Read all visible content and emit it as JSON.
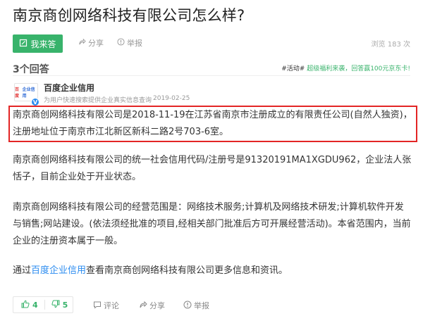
{
  "question": {
    "title": "南京商创网络科技有限公司怎么样?"
  },
  "actions": {
    "answer_label": "我来答",
    "share_label": "分享",
    "report_label": "举报",
    "views_text": "浏览 183 次"
  },
  "answers_header": {
    "count_text": "3个回答",
    "promo_tag": "#活动#",
    "promo_text": "超级福利来袭，回答赢100元京东卡!"
  },
  "answer": {
    "author": {
      "logo_text_1": "百度",
      "logo_text_2": "企业信用",
      "verified_mark": "V",
      "name": "百度企业信用",
      "meta": "为用户快速搜索提供企业真实信息查询",
      "date": "2019-02-25"
    },
    "highlight_lines": [
      "南京商创网络科技有限公司是2018-11-19在江苏省南京市注册成立的有限责任公司(自然人独资)，",
      "注册地址位于南京市江北新区新科二路2号703-6室。"
    ],
    "para1": "南京商创网络科技有限公司的统一社会信用代码/注册号是91320191MA1XGDU962，企业法人张恬子，目前企业处于开业状态。",
    "para2": "南京商创网络科技有限公司的经营范围是：网络技术服务;计算机及网络技术研发;计算机软件开发与销售;网站建设。(依法须经批准的项目,经相关部门批准后方可开展经营活动)。本省范围内，当前企业的注册资本属于一般。",
    "para3_prefix": "通过",
    "para3_link": "百度企业信用",
    "para3_suffix": "查看南京商创网络科技有限公司更多信息和资讯。"
  },
  "footer": {
    "like_count": "4",
    "dislike_count": "5",
    "comment_label": "评论",
    "share_label": "分享",
    "report_label": "举报"
  },
  "colors": {
    "brand_green": "#38b36b",
    "highlight_red": "#e32525",
    "link_blue": "#2b8cf0"
  },
  "icons": [
    "edit-icon",
    "share-icon",
    "report-icon",
    "thumbs-up-icon",
    "thumbs-down-icon",
    "comment-icon",
    "verified-icon"
  ]
}
